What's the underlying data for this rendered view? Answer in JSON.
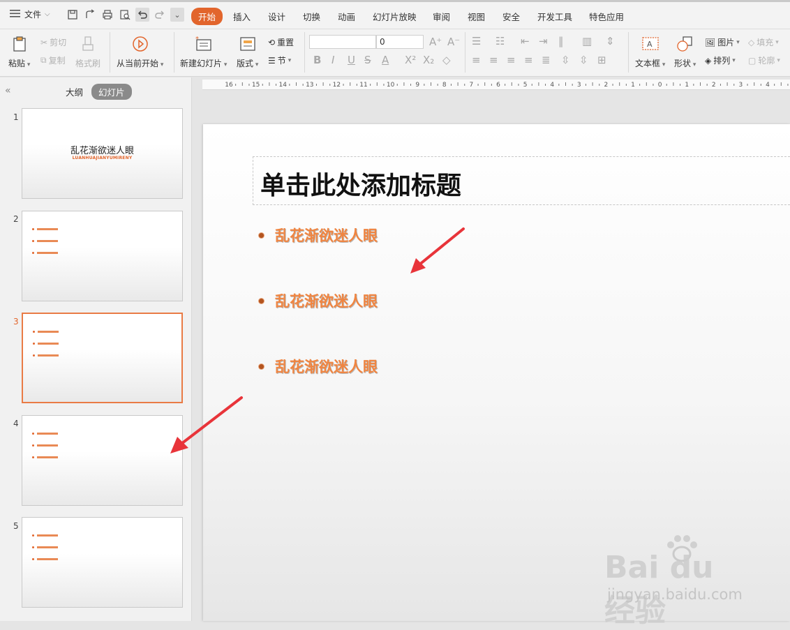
{
  "menu": {
    "file_label": "文件"
  },
  "tabs": [
    "开始",
    "插入",
    "设计",
    "切换",
    "动画",
    "幻灯片放映",
    "审阅",
    "视图",
    "安全",
    "开发工具",
    "特色应用"
  ],
  "ribbon": {
    "paste": "粘贴",
    "cut": "剪切",
    "copy": "复制",
    "format_painter": "格式刷",
    "from_current": "从当前开始",
    "new_slide": "新建幻灯片",
    "layout": "版式",
    "reset": "重置",
    "section": "节",
    "font_size": "0",
    "textbox": "文本框",
    "shape": "形状",
    "picture": "图片",
    "arrange": "排列",
    "fill": "填充",
    "outline": "轮廓"
  },
  "panel": {
    "tab_outline": "大纲",
    "tab_slides": "幻灯片"
  },
  "slides": [
    {
      "num": "1",
      "title": "乱花渐欲迷人眼",
      "subtitle": "LUANHUAJIANYUMIRENY"
    },
    {
      "num": "2"
    },
    {
      "num": "3"
    },
    {
      "num": "4"
    },
    {
      "num": "5"
    }
  ],
  "canvas": {
    "title_placeholder": "单击此处添加标题",
    "bullets": [
      "乱花渐欲迷人眼",
      "乱花渐欲迷人眼",
      "乱花渐欲迷人眼"
    ]
  },
  "ruler": {
    "labels": [
      "16",
      "15",
      "14",
      "13",
      "12",
      "11",
      "10",
      "9",
      "8",
      "7",
      "6",
      "5",
      "4",
      "3",
      "2",
      "1",
      "0",
      "1",
      "2",
      "3",
      "4",
      "5"
    ]
  },
  "watermark": {
    "logo": "Bai du 经验",
    "url": "jingyan.baidu.com"
  },
  "colors": {
    "accent": "#e2652c",
    "bullet_text": "#f08541",
    "arrow": "#e8343a"
  },
  "icons": [
    "menu-icon",
    "save-icon",
    "undo-icon",
    "redo-icon",
    "print-icon",
    "preview-icon",
    "play-icon"
  ]
}
